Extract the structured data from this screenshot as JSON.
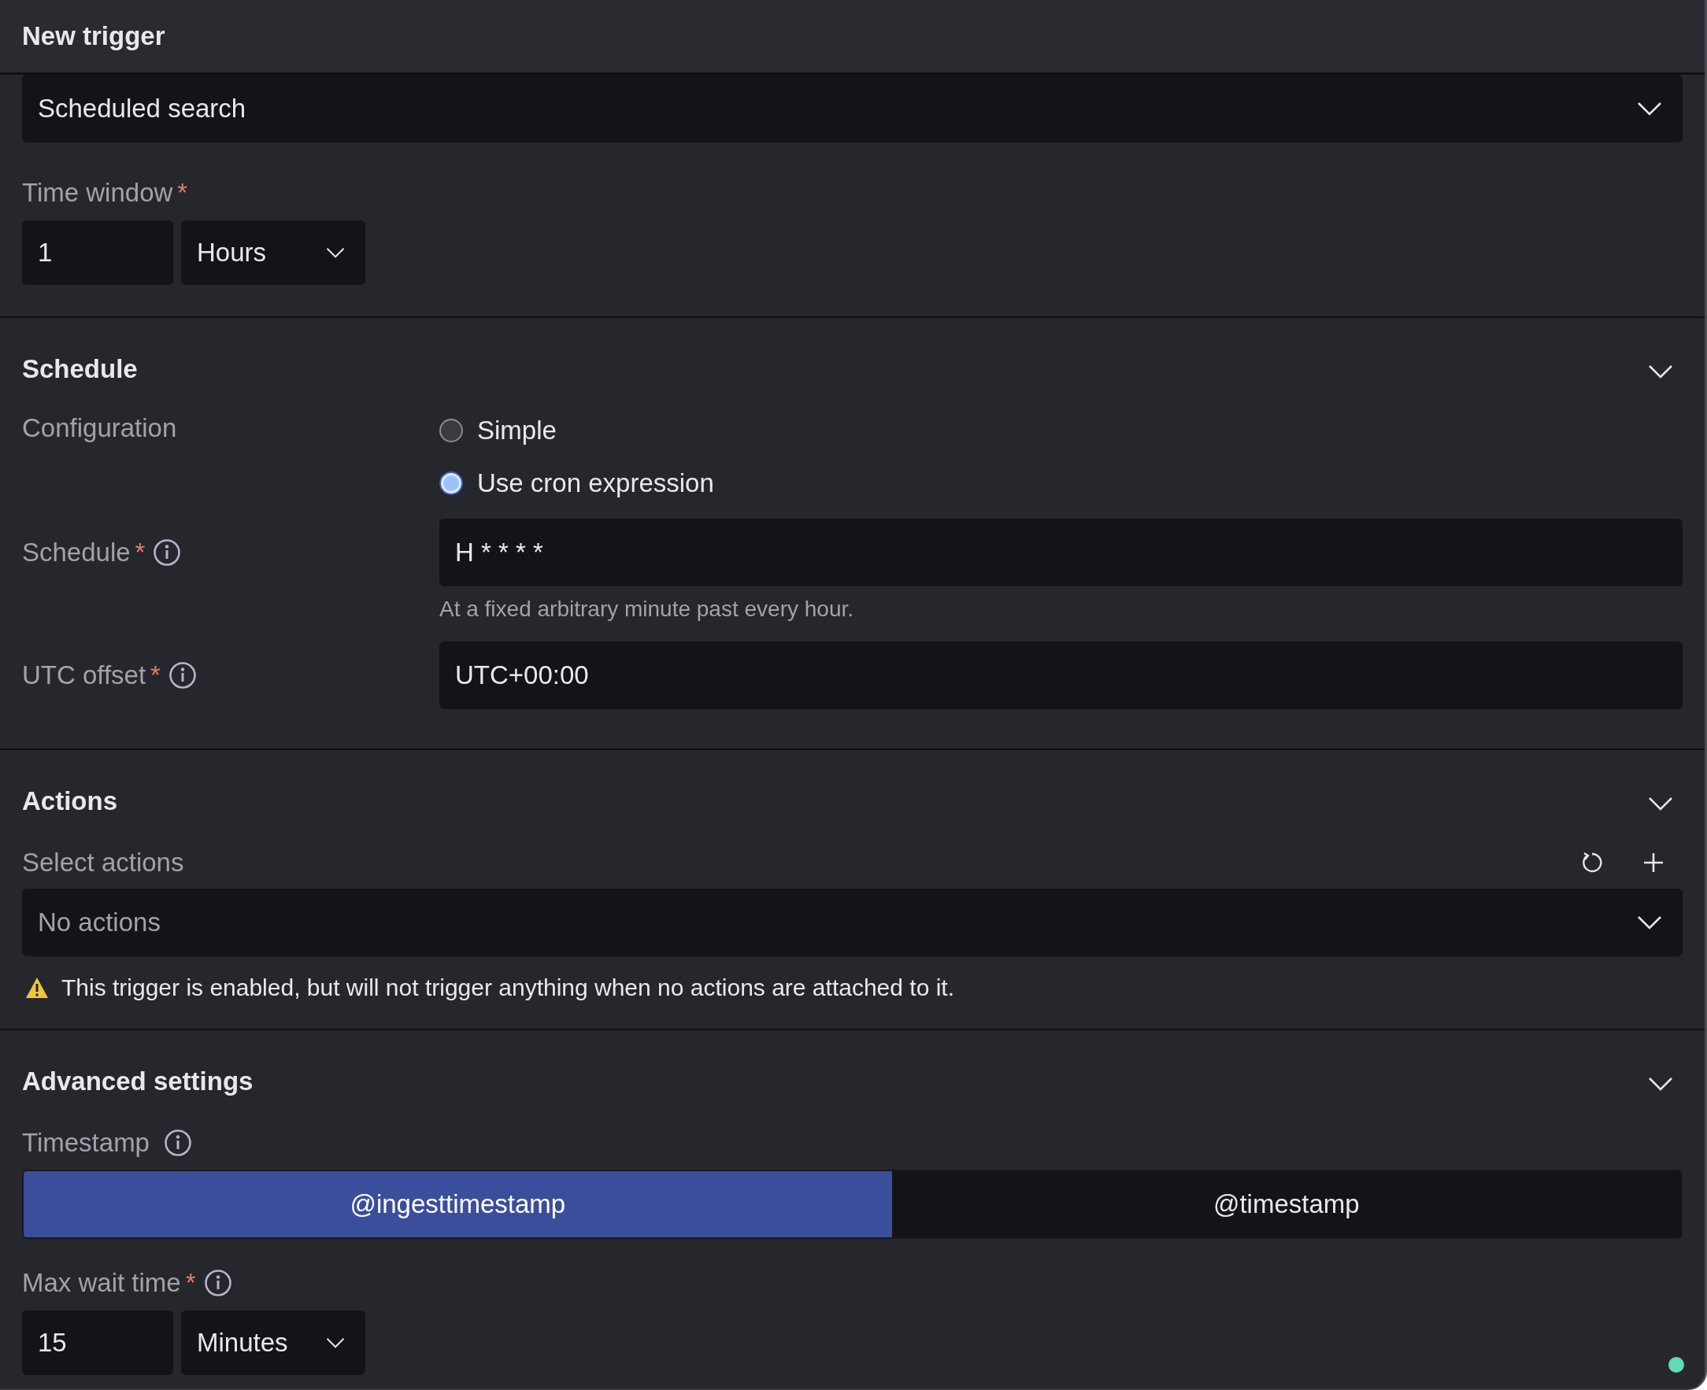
{
  "title": "New trigger",
  "trigger_type": {
    "value": "Scheduled search"
  },
  "time_window": {
    "label": "Time window",
    "required_mark": "*",
    "value": "1",
    "unit": "Hours"
  },
  "schedule": {
    "title": "Schedule",
    "expanded": true,
    "configuration": {
      "label": "Configuration",
      "options": [
        {
          "label": "Simple",
          "selected": false
        },
        {
          "label": "Use cron expression",
          "selected": true
        }
      ]
    },
    "fields": [
      {
        "label": "Schedule",
        "required_mark": "*",
        "info": true,
        "value": "H * * * *",
        "help": "At a fixed arbitrary minute past every hour."
      },
      {
        "label": "UTC offset",
        "required_mark": "*",
        "info": true,
        "value": "UTC+00:00"
      }
    ]
  },
  "actions": {
    "title": "Actions",
    "expanded": true,
    "label": "Select actions",
    "placeholder": "No actions",
    "warning": "This trigger is enabled, but will not trigger anything when no actions are attached to it."
  },
  "advanced": {
    "title": "Advanced settings",
    "expanded": true,
    "timestamp": {
      "label": "Timestamp",
      "info": true,
      "options": [
        {
          "label": "@ingesttimestamp",
          "selected": true
        },
        {
          "label": "@timestamp",
          "selected": false
        }
      ]
    },
    "max_wait": {
      "label": "Max wait time",
      "required_mark": "*",
      "info": true,
      "value": "15",
      "unit": "Minutes"
    }
  }
}
